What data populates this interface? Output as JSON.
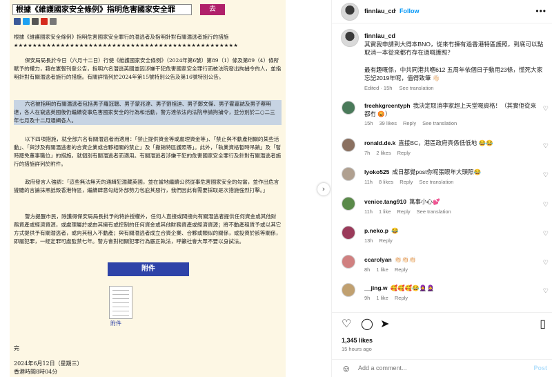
{
  "media": {
    "search_text": "根據《維護國家安全條例》指明危害國家安全罪",
    "go_label": "去",
    "share_icons": [
      {
        "name": "facebook-icon",
        "color": "#3b5998"
      },
      {
        "name": "twitter-icon",
        "color": "#1da1f2"
      },
      {
        "name": "email-icon",
        "color": "#555555"
      },
      {
        "name": "weibo-icon",
        "color": "#d52b1e"
      },
      {
        "name": "print-icon",
        "color": "#777777"
      }
    ],
    "title_line": "根據《維護國家安全條例》指明危害國家安全罪行的潛逃者及指明針對有關潛逃者施行的措施",
    "stars": "★★★★★★★★★★★★★★★★★★★★★★★★★★★★★★★★★★★★★★★★★★★★★★★★",
    "p1": "保安局局長於今日（六月十二日）行使《維護國家安全條例》（2024年第6號）第89（1）條及第89（4）條所賦予的權力，藉在憲報刊登公告，指明六名潛逃英國並因涉嫌干犯危害國家安全罪行而被法院發出拘捕令的人，並指明針對有關潛逃者施行的措施。有關詳情列於2024年第15號特別公告及第16號特別公告。",
    "p2": "六名被指明的有關潛逃者包括男子羅冠聰、男子蒙兆達、男子劉祖迪、男子鄭文傑、男子霍嘉誌及男子蔡明達，各人在竄逃英國後仍繼續從事危害國家安全的行為和活動，警方達依法向法院申請拘捕令，並分別於二○二三年七月及十二月通緝各人。",
    "p3": "以下四項措施，就全部六名有關潛逃者而適用：「禁止提供資金等或處理資金等」、「禁止與不動產相關的某些活動」、「與涉及有關潛逃者的合資企業或合夥相關的禁止」及「撤銷特區護照等」。此外，「執業資格暫時吊銷」及「暫時罷免董事職位」的措施，就個別有關潛逃者而適用。有關潛逃者涉嫌干犯的危害國家安全罪行及針對有關潛逃者施行的措施詳列於附件。",
    "p4": "政府發言人強調：「這些無法無天的通緝犯潛藏英國，並在當地繼續公然從事危害國家安全的勾當，並作出危言聳聽的言論抹黑詆毀香港特區，繼續肆意勾結外部勢力包庇其惡行，我們因此有需要採取是次措施強烈打擊。」",
    "p5": "警方提醒市民，除獲得保安局局長批予的特許授權外，任何人直接或間接向有關潛逃者提供任何資金或其他財務資產或經濟資源，或處理屬於或由其擁有或控制的任何資金或其他財務資產或經濟資源；將不動產租賃予或以其它方式提供予有關潛逃者，或向其租入不動產；與有關潛逃者成立合資企業、合夥或類似的關係，或投資於該等關係，即屬犯罪，一經定罪可處監禁七年。警方會對相關犯罪行為嚴正執法，呼籲社會大眾不要以身試法。",
    "attachment_bar": "附件",
    "attachment_label": "附件",
    "end_mark": "完",
    "date": "2024年6月12日（星期三）",
    "time": "香港時間8時04分"
  },
  "header": {
    "username": "finnlau_cd",
    "follow": "Follow"
  },
  "caption": {
    "username": "finnlau_cd",
    "text1": "其實我申請到大得本BNO，從來冇揀有過香港特區護照，到底可以點取消一本從來都冇存在過嘅護照？",
    "text2": "最有趣嘅係，中共同港共嗰612 五周年依個日子動用23條，慌死大家忘記2019年呢，值得致筆 👋🏻",
    "edited": "Edited · 15h",
    "see_translation": "See translation"
  },
  "comments": [
    {
      "user": "freehkgreentyph",
      "text": "我決定取消李家超上天堂嘅資格！（其實佢從來都冇 😡）",
      "time": "15h",
      "likes": "39 likes",
      "reply": "Reply",
      "translation": "See translation",
      "avatar_color": "#4a7a5a"
    },
    {
      "user": "ronald.de.k",
      "text": "直接BC，港區政府真係低低地 😂😂",
      "time": "7h",
      "likes": "2 likes",
      "reply": "Reply",
      "translation": "",
      "avatar_color": "#8a7060"
    },
    {
      "user": "lyoko525",
      "text": "成日都覺post你呢張眼年大頭照😂",
      "time": "11h",
      "likes": "8 likes",
      "reply": "Reply",
      "translation": "See translation",
      "avatar_color": "#b0a090"
    },
    {
      "user": "venice.tang910",
      "text": "萬事小心💕",
      "time": "11h",
      "likes": "1 like",
      "reply": "Reply",
      "translation": "See translation",
      "avatar_color": "#5a8a4a"
    },
    {
      "user": "p.neko.p",
      "text": "😂",
      "time": "13h",
      "likes": "",
      "reply": "Reply",
      "translation": "",
      "avatar_color": "#9a3a5a"
    },
    {
      "user": "ccarolyan",
      "text": "👏🏻👏🏻👏🏻",
      "time": "8h",
      "likes": "1 like",
      "reply": "Reply",
      "translation": "",
      "avatar_color": "#d08080"
    },
    {
      "user": "__jing.w",
      "text": "🥰🥰🥰😂🧕🧕",
      "time": "9h",
      "likes": "1 like",
      "reply": "Reply",
      "translation": "",
      "avatar_color": "#c0a070"
    }
  ],
  "footer": {
    "likes": "1,345 likes",
    "ago": "15 hours ago",
    "comment_placeholder": "Add a comment...",
    "post": "Post"
  }
}
